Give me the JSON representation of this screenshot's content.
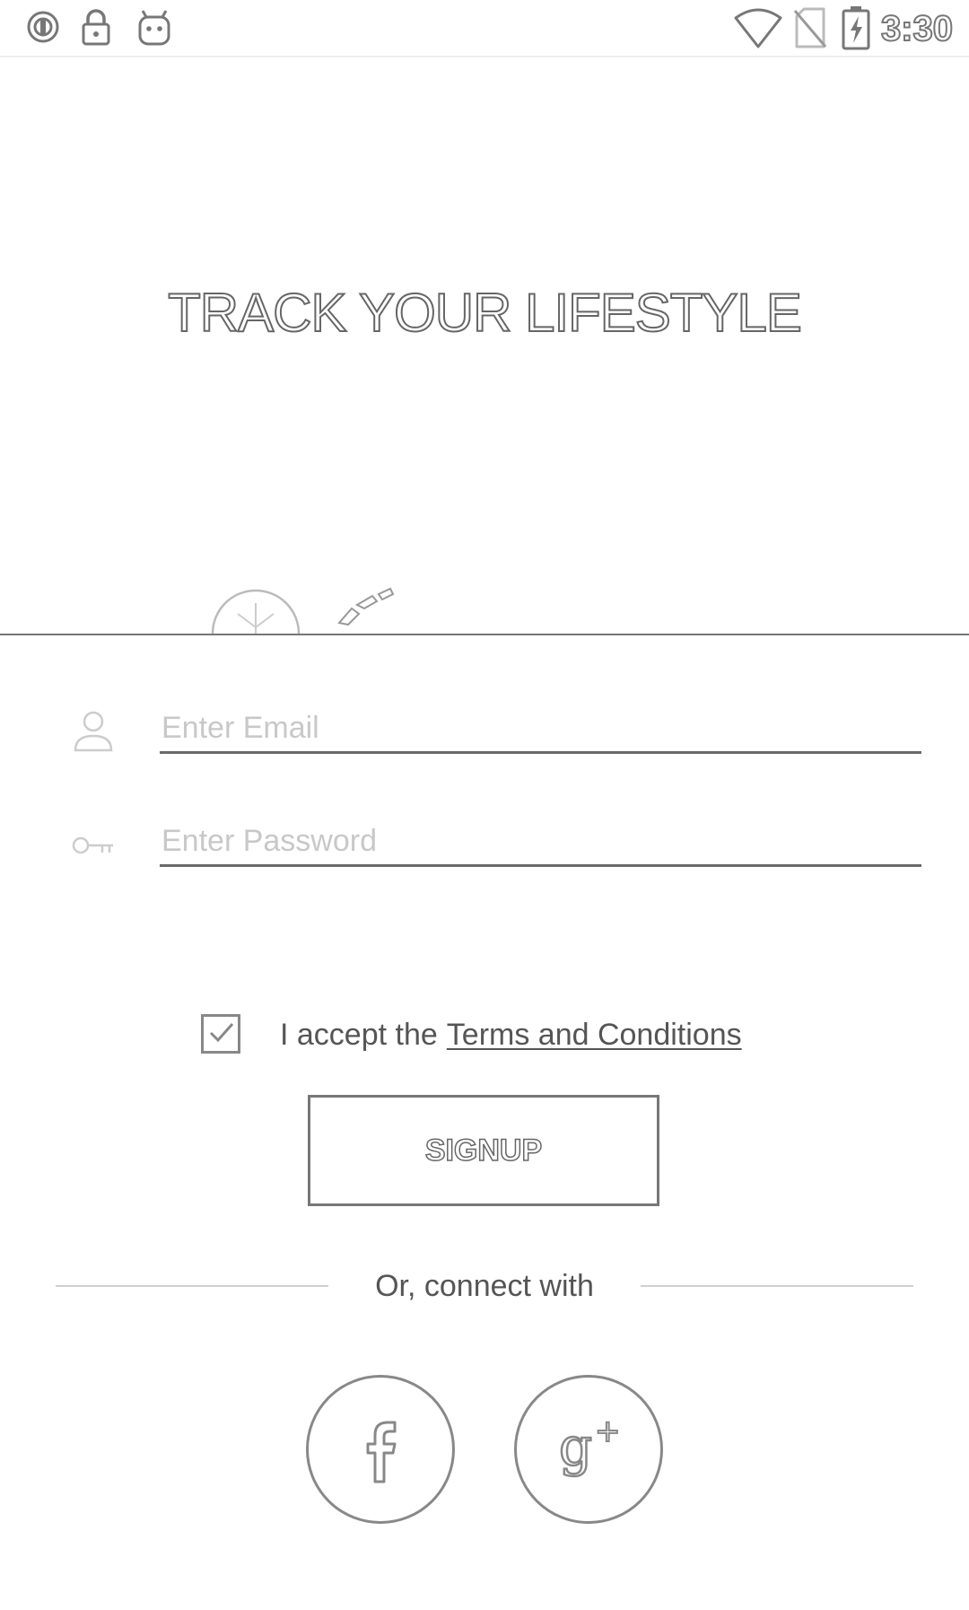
{
  "status_bar": {
    "time": "3:30",
    "left_icons": [
      "data-saver-icon",
      "lock-icon",
      "android-icon"
    ],
    "right_icons": [
      "wifi-icon",
      "no-sim-icon",
      "battery-charging-icon"
    ]
  },
  "hero": {
    "title": "TRACK YOUR LIFESTYLE"
  },
  "form": {
    "email_placeholder": "Enter Email",
    "password_placeholder": "Enter Password",
    "terms_prefix": "I accept the",
    "terms_link": "Terms and Conditions",
    "terms_checked": true,
    "signup_label": "SIGNUP"
  },
  "social": {
    "divider_text": "Or, connect with",
    "buttons": [
      "facebook-icon",
      "google-plus-icon"
    ]
  }
}
